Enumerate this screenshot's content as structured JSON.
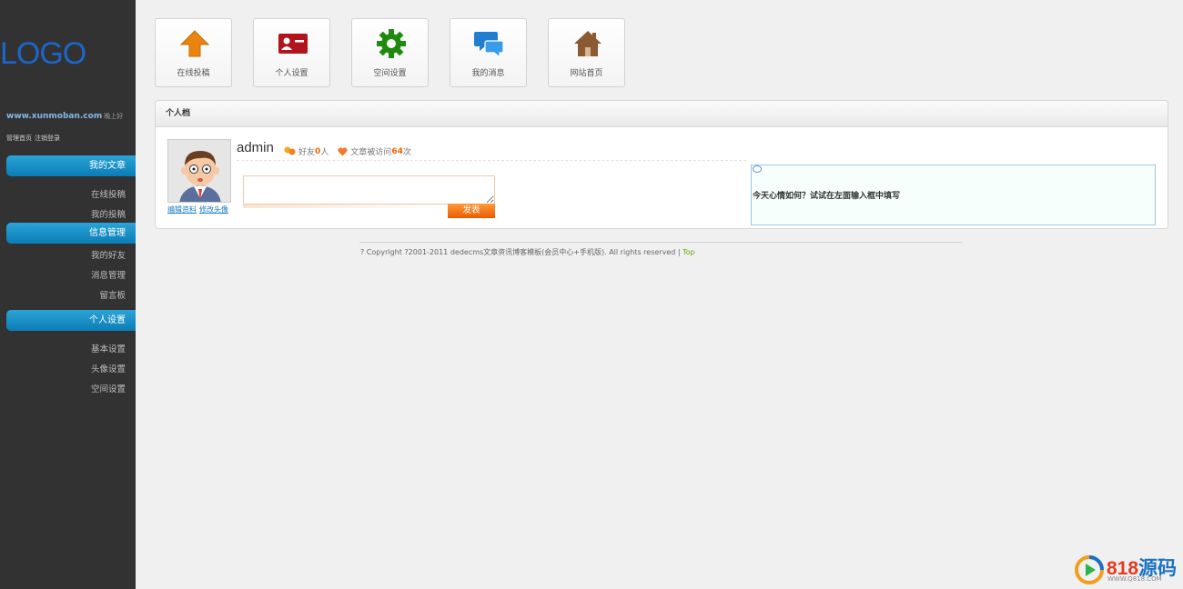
{
  "sidebar": {
    "logo": "LOGO",
    "site_url": "www.xunmoban.com",
    "greeting": "晚上好",
    "user_links": [
      "管理首页",
      "注销登录"
    ],
    "sections": [
      {
        "title": "我的文章",
        "items": [
          "在线投稿",
          "我的投稿"
        ]
      },
      {
        "title": "信息管理",
        "items": [
          "我的好友",
          "消息管理",
          "留言板"
        ]
      },
      {
        "title": "个人设置",
        "items": [
          "基本设置",
          "头像设置",
          "空间设置"
        ]
      }
    ]
  },
  "toolbar": {
    "tiles": [
      {
        "label": "在线投稿",
        "icon": "upload-arrow-icon",
        "color": "#e8830d"
      },
      {
        "label": "个人设置",
        "icon": "id-card-icon",
        "color": "#b1141c"
      },
      {
        "label": "空间设置",
        "icon": "gear-icon",
        "color": "#1e8a0e"
      },
      {
        "label": "我的消息",
        "icon": "chat-bubbles-icon",
        "color": "#1f7ed0"
      },
      {
        "label": "网站首页",
        "icon": "home-icon",
        "color": "#8a5a32"
      }
    ]
  },
  "profile": {
    "header": "个人档",
    "username": "admin",
    "avatar_links": [
      "编辑资料",
      "修改头像"
    ],
    "friends_label_pre": "好友",
    "friends_count": "0",
    "friends_label_post": "人",
    "visits_label_pre": "文章被访问",
    "visits_count": "64",
    "visits_label_post": "次",
    "mood_value": "",
    "post_button": "发表",
    "mood_hint": "今天心情如何？试试在左面输入框中填写"
  },
  "footer": {
    "copyright": "? Copyright ?2001-2011 dedecms文章资讯博客模板(会员中心+手机版). All rights reserved | ",
    "top_link": "Top"
  },
  "watermark": {
    "brand_num": "818",
    "brand_text": "源码",
    "url": "WWW.Q818.COM"
  }
}
